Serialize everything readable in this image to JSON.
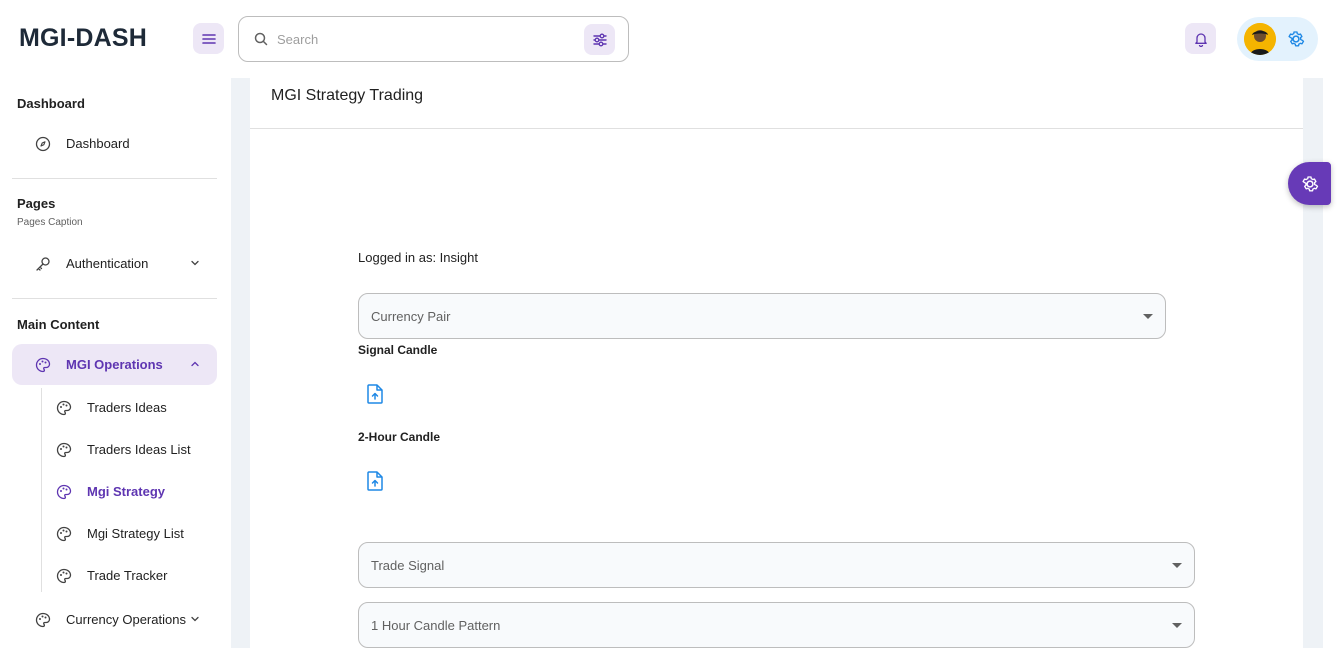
{
  "app": {
    "logo": "MGI-DASH"
  },
  "search": {
    "placeholder": "Search"
  },
  "sidebar": {
    "sections": [
      {
        "title": "Dashboard"
      },
      {
        "title": "Pages",
        "caption": "Pages Caption"
      },
      {
        "title": "Main Content"
      }
    ],
    "items": {
      "dashboard": "Dashboard",
      "authentication": "Authentication",
      "mgi_operations": "MGI Operations",
      "currency_operations": "Currency Operations"
    },
    "sub_items": [
      {
        "label": "Traders Ideas"
      },
      {
        "label": "Traders Ideas List"
      },
      {
        "label": "Mgi Strategy"
      },
      {
        "label": "Mgi Strategy List"
      },
      {
        "label": "Trade Tracker"
      }
    ]
  },
  "main": {
    "title": "MGI Strategy Trading",
    "logged_in": "Logged in as: Insight",
    "currency_pair": "Currency Pair",
    "signal_candle": "Signal Candle",
    "two_hour_candle": "2-Hour Candle",
    "trade_signal": "Trade Signal",
    "one_hour_pattern": "1 Hour Candle Pattern"
  },
  "colors": {
    "accent": "#5e35b1",
    "accent_light": "#ede7f6",
    "fab": "#673ab7",
    "upload": "#1e88e5"
  }
}
